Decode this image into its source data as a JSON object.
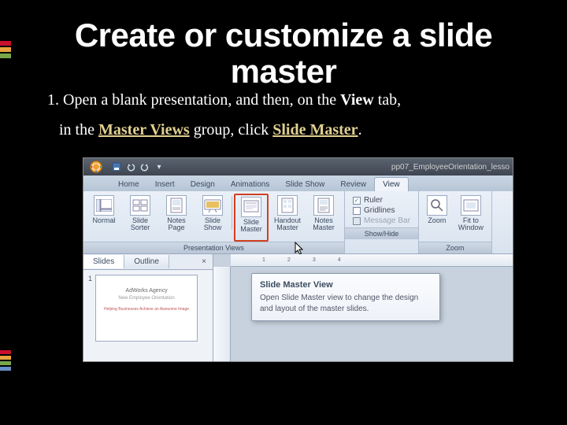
{
  "slide": {
    "title_line1": "Create or customize a slide",
    "title_line2": "master",
    "step_prefix": "1. Open a blank presentation, and then, on the ",
    "view_tab": "View",
    "step_mid": " tab,",
    "step_line2_a": "in the ",
    "master_views": "Master Views",
    "step_line2_b": " group, click ",
    "slide_master": "Slide Master",
    "step_line2_c": "."
  },
  "ppt": {
    "window_title": "pp07_EmployeeOrientation_lesso",
    "tabs": [
      "Home",
      "Insert",
      "Design",
      "Animations",
      "Slide Show",
      "Review",
      "View"
    ],
    "active_tab": "View",
    "groups": {
      "presentation_views": {
        "label": "Presentation Views",
        "buttons": [
          {
            "label": "Normal"
          },
          {
            "label": "Slide Sorter"
          },
          {
            "label": "Notes Page"
          },
          {
            "label": "Slide Show"
          },
          {
            "label": "Slide Master",
            "highlight": true
          },
          {
            "label": "Handout Master"
          },
          {
            "label": "Notes Master"
          }
        ]
      },
      "show_hide": {
        "label": "Show/Hide",
        "checks": [
          {
            "label": "Ruler",
            "checked": true
          },
          {
            "label": "Gridlines",
            "checked": false
          },
          {
            "label": "Message Bar",
            "checked": false,
            "disabled": true
          }
        ]
      },
      "zoom": {
        "label": "Zoom",
        "buttons": [
          {
            "label": "Zoom"
          },
          {
            "label": "Fit to Window"
          }
        ]
      }
    },
    "panel": {
      "tabs": [
        "Slides",
        "Outline"
      ],
      "active": "Slides",
      "thumb": {
        "num": "1",
        "line1": "AdWorks Agency",
        "line2": "New Employee Orientation",
        "line3": "Helping Businesses Achieve an Awesome Image"
      }
    },
    "ruler_marks": [
      "1",
      "2",
      "3",
      "4"
    ],
    "tooltip": {
      "title": "Slide Master View",
      "body": "Open Slide Master view to change the design and layout of the master slides."
    }
  },
  "colors": {
    "stripes": [
      "#c8102e",
      "#e8a33d",
      "#7aa64a",
      "#6b8fc9",
      "#4a6aa5"
    ]
  }
}
